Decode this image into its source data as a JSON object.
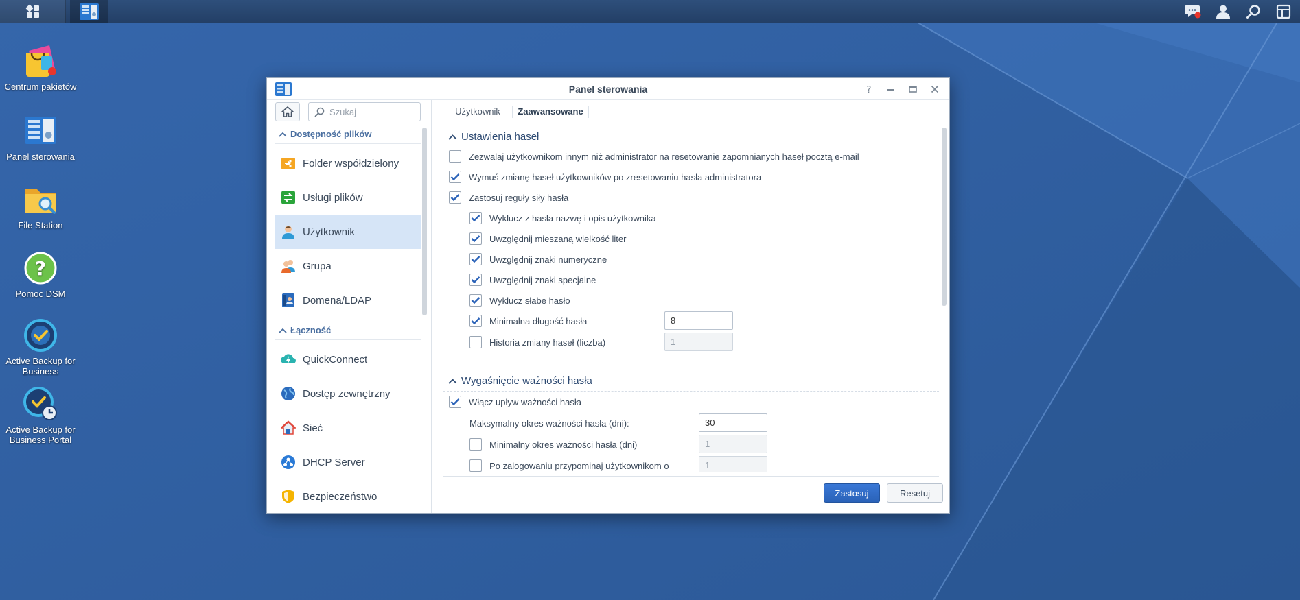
{
  "desktop": {
    "icons": [
      {
        "label": "Centrum pakietów",
        "icon": "package-center-icon"
      },
      {
        "label": "Panel sterowania",
        "icon": "control-panel-icon"
      },
      {
        "label": "File Station",
        "icon": "file-station-icon"
      },
      {
        "label": "Pomoc DSM",
        "icon": "help-icon"
      },
      {
        "label": "Active Backup for Business",
        "icon": "active-backup-icon"
      },
      {
        "label": "Active Backup for Business Portal",
        "icon": "active-backup-portal-icon"
      }
    ]
  },
  "taskbar": {
    "right_icons": [
      "notification-icon",
      "user-icon",
      "search-icon",
      "widgets-icon"
    ]
  },
  "window": {
    "title": "Panel sterowania",
    "controls": [
      "help-icon",
      "minimize-icon",
      "maximize-icon",
      "close-icon"
    ]
  },
  "sidebar": {
    "search_placeholder": "Szukaj",
    "sections": [
      {
        "title": "Dostępność plików",
        "items": [
          {
            "label": "Folder współdzielony",
            "icon": "shared-folder-icon",
            "color": "#f5a623"
          },
          {
            "label": "Usługi plików",
            "icon": "file-services-icon",
            "color": "#2aa43a"
          },
          {
            "label": "Użytkownik",
            "icon": "user-icon",
            "color": "#2f9ad6",
            "active": true
          },
          {
            "label": "Grupa",
            "icon": "group-icon",
            "color": "#e86a2c"
          },
          {
            "label": "Domena/LDAP",
            "icon": "domain-ldap-icon",
            "color": "#2a6bbd"
          }
        ]
      },
      {
        "title": "Łączność",
        "items": [
          {
            "label": "QuickConnect",
            "icon": "quickconnect-icon",
            "color": "#2ab3b0"
          },
          {
            "label": "Dostęp zewnętrzny",
            "icon": "external-access-icon",
            "color": "#2a6bbd"
          },
          {
            "label": "Sieć",
            "icon": "network-icon",
            "color": "#e0463a"
          },
          {
            "label": "DHCP Server",
            "icon": "dhcp-server-icon",
            "color": "#2a7ad6"
          },
          {
            "label": "Bezpieczeństwo",
            "icon": "security-icon",
            "color": "#f5b400"
          }
        ]
      }
    ]
  },
  "tabs": [
    {
      "label": "Użytkownik",
      "active": false
    },
    {
      "label": "Zaawansowane",
      "active": true
    }
  ],
  "password_settings": {
    "title": "Ustawienia haseł",
    "options": [
      {
        "label": "Zezwalaj użytkownikom innym niż administrator na resetowanie zapomnianych haseł pocztą e-mail",
        "checked": false,
        "indent": 0
      },
      {
        "label": "Wymuś zmianę haseł użytkowników po zresetowaniu hasła administratora",
        "checked": true,
        "indent": 0
      },
      {
        "label": "Zastosuj reguły siły hasła",
        "checked": true,
        "indent": 0
      },
      {
        "label": "Wyklucz z hasła nazwę i opis użytkownika",
        "checked": true,
        "indent": 1
      },
      {
        "label": "Uwzględnij mieszaną wielkość liter",
        "checked": true,
        "indent": 1
      },
      {
        "label": "Uwzględnij znaki numeryczne",
        "checked": true,
        "indent": 1
      },
      {
        "label": "Uwzględnij znaki specjalne",
        "checked": true,
        "indent": 1
      },
      {
        "label": "Wyklucz słabe hasło",
        "checked": true,
        "indent": 1
      },
      {
        "label": "Minimalna długość hasła",
        "checked": true,
        "indent": 1,
        "value": "8",
        "disabled": false
      },
      {
        "label": "Historia zmiany haseł (liczba)",
        "checked": false,
        "indent": 1,
        "value": "1",
        "disabled": true
      }
    ]
  },
  "password_expiry": {
    "title": "Wygaśnięcie ważności hasła",
    "enable_label": "Włącz upływ ważności hasła",
    "enable_checked": true,
    "max_label": "Maksymalny okres ważności hasła (dni):",
    "max_value": "30",
    "min_label": "Minimalny okres ważności hasła (dni)",
    "min_checked": false,
    "min_value": "1",
    "remind_label": "Po zalogowaniu przypominaj użytkownikom o",
    "remind_checked": false,
    "remind_value": "1"
  },
  "footer": {
    "apply_label": "Zastosuj",
    "reset_label": "Resetuj"
  },
  "colors": {
    "accent": "#2a62b8",
    "checkbox_tick": "#2a62b8",
    "active_item_bg": "#d6e5f7"
  }
}
